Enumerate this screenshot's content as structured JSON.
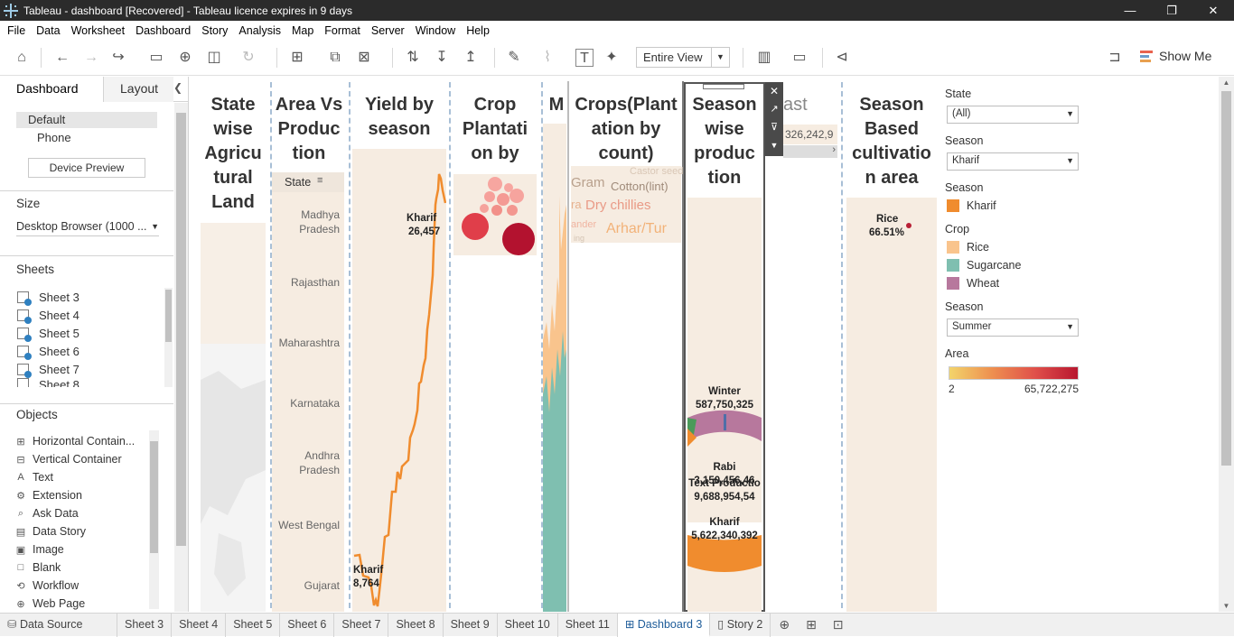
{
  "window": {
    "title": "Tableau - dashboard [Recovered] - Tableau licence expires in 9 days",
    "minimize": "—",
    "maximize": "❐",
    "close": "✕"
  },
  "menu": [
    "File",
    "Data",
    "Worksheet",
    "Dashboard",
    "Story",
    "Analysis",
    "Map",
    "Format",
    "Server",
    "Window",
    "Help"
  ],
  "toolbar": {
    "view_mode": "Entire View",
    "show_me": "Show Me"
  },
  "left_panel": {
    "tabs": [
      "Dashboard",
      "Layout"
    ],
    "device": {
      "default": "Default",
      "phone": "Phone",
      "preview_button": "Device Preview"
    },
    "size": {
      "heading": "Size",
      "value": "Desktop Browser (1000 ..."
    },
    "sheets": {
      "heading": "Sheets",
      "items": [
        "Sheet 3",
        "Sheet 4",
        "Sheet 5",
        "Sheet 6",
        "Sheet 7",
        "Sheet 8"
      ]
    },
    "objects": {
      "heading": "Objects",
      "items": [
        {
          "label": "Horizontal Contain...",
          "icon": "⊞"
        },
        {
          "label": "Vertical Container",
          "icon": "⊟"
        },
        {
          "label": "Text",
          "icon": "A"
        },
        {
          "label": "Extension",
          "icon": "⚙"
        },
        {
          "label": "Ask Data",
          "icon": "⌕"
        },
        {
          "label": "Data Story",
          "icon": "▤"
        },
        {
          "label": "Image",
          "icon": "▣"
        },
        {
          "label": "Blank",
          "icon": "□"
        },
        {
          "label": "Workflow",
          "icon": "⟲"
        },
        {
          "label": "Web Page",
          "icon": "⊕"
        }
      ]
    }
  },
  "dashboard": {
    "sheet_titles": {
      "state_wise": "State wise Agricu tural Land",
      "area_vs": "Area Vs Produc tion",
      "yield": "Yield by season",
      "crop_plant": "Crop Plantati on by",
      "m": "M",
      "crops_count": "Crops(Plant ation by count)",
      "season_prod": "Season wise produc tion",
      "season_area": "Season Based cultivatio n area",
      "partial_ast": "ast"
    },
    "area_vs_header": "State",
    "states": [
      "Madhya Pradesh",
      "Rajasthan",
      "Maharashtra",
      "Karnataka",
      "Andhra Pradesh",
      "West Bengal",
      "Gujarat"
    ],
    "yield_labels": {
      "top_season": "Kharif",
      "top_value": "26,457",
      "bottom_season": "Kharif",
      "bottom_value": "8,764"
    },
    "word_cloud": [
      "Castor seed",
      "Gram",
      "Cotton(lint)",
      "ra",
      "Dry chillies",
      "ander",
      "Arhar/Tur",
      "ing"
    ],
    "forecast_value": "326,242,9",
    "season_prod_labels": {
      "winter_label": "Winter",
      "winter_value": "587,750,325",
      "rabi_label": "Rabi",
      "rabi_value": "3,150,456,46",
      "text_prod": "Text Productio",
      "text_prod_value": "9,688,954,54",
      "kharif_label": "Kharif",
      "kharif_value": "5,622,340,392"
    },
    "season_area_labels": {
      "crop": "Rice",
      "pct": "66.51%"
    }
  },
  "legend": {
    "state": {
      "title": "State",
      "value": "(All)"
    },
    "season1": {
      "title": "Season",
      "value": "Kharif"
    },
    "season2": {
      "title": "Season",
      "item": "Kharif",
      "color": "#f08c2e"
    },
    "crop": {
      "title": "Crop",
      "items": [
        {
          "label": "Rice",
          "color": "#f9c48d"
        },
        {
          "label": "Sugarcane",
          "color": "#7fbfb0"
        },
        {
          "label": "Wheat",
          "color": "#b7789d"
        }
      ]
    },
    "season3": {
      "title": "Season",
      "value": "Summer"
    },
    "area": {
      "title": "Area",
      "min": "2",
      "max": "65,722,275"
    }
  },
  "bottom_tabs": [
    "Data Source",
    "Sheet 3",
    "Sheet 4",
    "Sheet 5",
    "Sheet 6",
    "Sheet 7",
    "Sheet 8",
    "Sheet 9",
    "Sheet 10",
    "Sheet 11",
    "Dashboard 3",
    "Story 2"
  ],
  "colors": {
    "accent": "#1e5c99",
    "line": "#f08c2e",
    "beige": "#f6ece1"
  }
}
